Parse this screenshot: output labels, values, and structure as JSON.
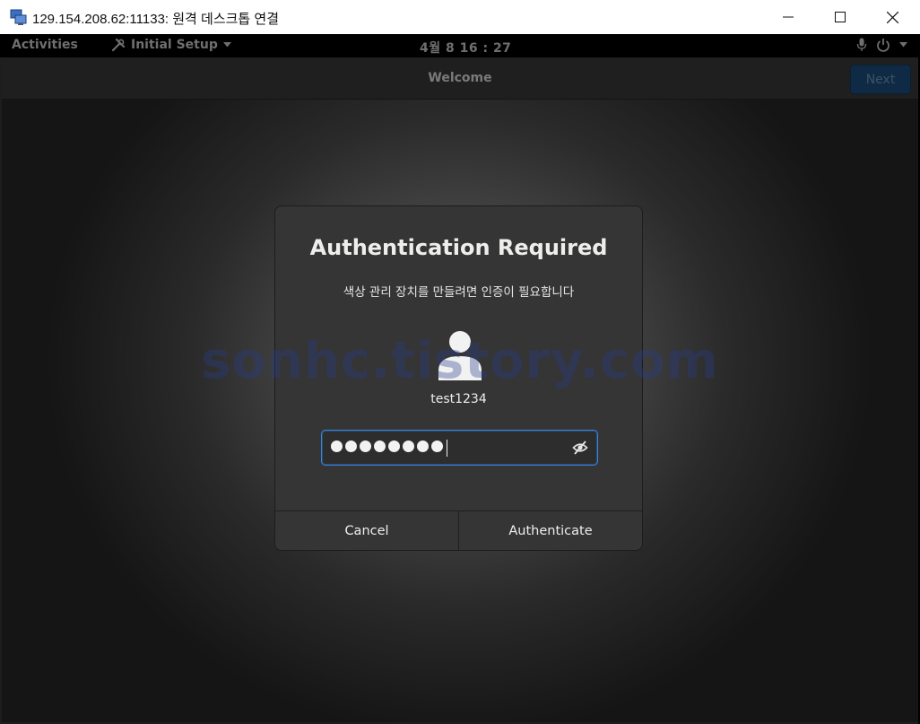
{
  "window": {
    "title": "129.154.208.62:11133: 원격 데스크톱 연결",
    "icon": "remote-desktop-icon",
    "controls": [
      "minimize",
      "maximize",
      "close"
    ]
  },
  "topbar": {
    "activities": "Activities",
    "app_menu": "Initial Setup",
    "clock": "4월 8  16 : 27"
  },
  "headerbar": {
    "title": "Welcome",
    "next_label": "Next"
  },
  "watermark": "sonhc.tistory.com",
  "dialog": {
    "title": "Authentication Required",
    "message": "색상 관리 장치를 만들려면 인증이 필요합니다",
    "username": "test1234",
    "password_length": 8,
    "cancel_label": "Cancel",
    "authenticate_label": "Authenticate"
  },
  "colors": {
    "focus": "#3584e4",
    "dialog_bg": "#353535"
  }
}
